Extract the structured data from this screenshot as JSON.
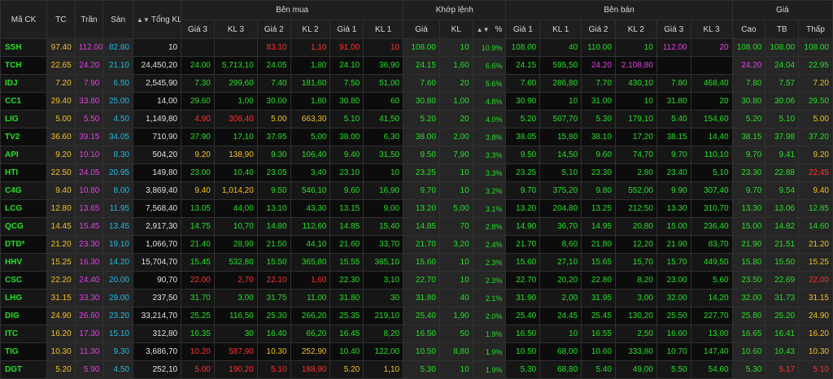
{
  "colors": {
    "ref": "#f0c020",
    "ceil": "#e040e0",
    "floor": "#20b8e0",
    "up": "#22e022",
    "down": "#ff3030",
    "vol": "#e0e0e0"
  },
  "header": {
    "symbol": "Mã CK",
    "ref": "TC",
    "ceil": "Trần",
    "floor": "Sàn",
    "total": "Tổng KL",
    "total_sort_icon": "sort-updown-icon",
    "buy_group": "Bên mua",
    "match_group": "Khớp lệnh",
    "sell_group": "Bên bán",
    "price_group": "Giá",
    "bid3": "Giá 3",
    "bvol3": "KL 3",
    "bid2": "Giá 2",
    "bvol2": "KL 2",
    "bid1": "Giá 1",
    "bvol1": "KL 1",
    "match_price": "Giá",
    "match_vol": "KL",
    "pct": "%",
    "pct_sort_icon": "sort-updown-icon",
    "ask1": "Giá 1",
    "avol1": "KL 1",
    "ask2": "Giá 2",
    "avol2": "KL 2",
    "ask3": "Giá 3",
    "avol3": "KL 3",
    "high": "Cao",
    "avg": "TB",
    "low": "Thấp"
  },
  "rows": [
    {
      "sym": "SSH",
      "tc": "97.40",
      "tran": "112.00",
      "san": "82.80",
      "tkl": "10",
      "g3": "",
      "k3": "",
      "g2": "83.10",
      "k2": "1,10",
      "g1": "91.00",
      "k1": "10",
      "mp": "108.00",
      "mv": "10",
      "pct": "10.9%",
      "ag1": "108.00",
      "ak1": "40",
      "ag2": "110.00",
      "ak2": "10",
      "ag3": "112.00",
      "ak3": "20",
      "hi": "108.00",
      "tb": "108.00",
      "lo": "108.00",
      "c": {
        "sym": "up",
        "g2": "down",
        "k2": "down",
        "g1": "down",
        "k1": "down",
        "mp": "up",
        "mv": "up",
        "pct": "up",
        "ag1": "up",
        "ak1": "up",
        "ag2": "up",
        "ak2": "up",
        "ag3": "ceil",
        "ak3": "ceil",
        "hi": "up",
        "tb": "up",
        "lo": "up"
      }
    },
    {
      "sym": "TCH",
      "tc": "22.65",
      "tran": "24.20",
      "san": "21.10",
      "tkl": "24,450,20",
      "g3": "24.00",
      "k3": "5,713,10",
      "g2": "24.05",
      "k2": "1,80",
      "g1": "24.10",
      "k1": "36,90",
      "mp": "24.15",
      "mv": "1,60",
      "pct": "6.6%",
      "ag1": "24.15",
      "ak1": "595,50",
      "ag2": "24.20",
      "ak2": "2,108,80",
      "ag3": "",
      "ak3": "",
      "hi": "24.20",
      "tb": "24.04",
      "lo": "22.95",
      "c": {
        "sym": "up",
        "g3": "up",
        "k3": "up",
        "g2": "up",
        "k2": "up",
        "g1": "up",
        "k1": "up",
        "mp": "up",
        "mv": "up",
        "pct": "up",
        "ag1": "up",
        "ak1": "up",
        "ag2": "ceil",
        "ak2": "ceil",
        "hi": "ceil",
        "tb": "up",
        "lo": "up"
      }
    },
    {
      "sym": "IDJ",
      "tc": "7.20",
      "tran": "7.90",
      "san": "6.50",
      "tkl": "2,545,90",
      "g3": "7.30",
      "k3": "299,60",
      "g2": "7.40",
      "k2": "181,60",
      "g1": "7.50",
      "k1": "51,00",
      "mp": "7.60",
      "mv": "20",
      "pct": "5.6%",
      "ag1": "7.60",
      "ak1": "286,80",
      "ag2": "7.70",
      "ak2": "430,10",
      "ag3": "7.80",
      "ak3": "468,40",
      "hi": "7.80",
      "tb": "7.57",
      "lo": "7.20",
      "c": {
        "sym": "up",
        "g3": "up",
        "k3": "up",
        "g2": "up",
        "k2": "up",
        "g1": "up",
        "k1": "up",
        "mp": "up",
        "mv": "up",
        "pct": "up",
        "ag1": "up",
        "ak1": "up",
        "ag2": "up",
        "ak2": "up",
        "ag3": "up",
        "ak3": "up",
        "hi": "up",
        "tb": "up",
        "lo": "ref"
      }
    },
    {
      "sym": "CC1",
      "tc": "29.40",
      "tran": "33.80",
      "san": "25.00",
      "tkl": "14,00",
      "g3": "29.60",
      "k3": "1,00",
      "g2": "30.00",
      "k2": "1,80",
      "g1": "30.80",
      "k1": "60",
      "mp": "30.80",
      "mv": "1,00",
      "pct": "4.8%",
      "ag1": "30.90",
      "ak1": "10",
      "ag2": "31.00",
      "ak2": "10",
      "ag3": "31.80",
      "ak3": "20",
      "hi": "30.80",
      "tb": "30.06",
      "lo": "29.50",
      "c": {
        "sym": "up",
        "g3": "up",
        "k3": "up",
        "g2": "up",
        "k2": "up",
        "g1": "up",
        "k1": "up",
        "mp": "up",
        "mv": "up",
        "pct": "up",
        "ag1": "up",
        "ak1": "up",
        "ag2": "up",
        "ak2": "up",
        "ag3": "up",
        "ak3": "up",
        "hi": "up",
        "tb": "up",
        "lo": "up"
      }
    },
    {
      "sym": "LIG",
      "tc": "5.00",
      "tran": "5.50",
      "san": "4.50",
      "tkl": "1,149,80",
      "g3": "4.90",
      "k3": "308,40",
      "g2": "5.00",
      "k2": "663,30",
      "g1": "5.10",
      "k1": "41,50",
      "mp": "5.20",
      "mv": "20",
      "pct": "4.0%",
      "ag1": "5.20",
      "ak1": "507,70",
      "ag2": "5.30",
      "ak2": "179,10",
      "ag3": "5.40",
      "ak3": "154,60",
      "hi": "5.20",
      "tb": "5.10",
      "lo": "5.00",
      "c": {
        "sym": "up",
        "g3": "down",
        "k3": "down",
        "g2": "ref",
        "k2": "ref",
        "g1": "up",
        "k1": "up",
        "mp": "up",
        "mv": "up",
        "pct": "up",
        "ag1": "up",
        "ak1": "up",
        "ag2": "up",
        "ak2": "up",
        "ag3": "up",
        "ak3": "up",
        "hi": "up",
        "tb": "up",
        "lo": "ref"
      }
    },
    {
      "sym": "TV2",
      "tc": "36.60",
      "tran": "39.15",
      "san": "34.05",
      "tkl": "710,90",
      "g3": "37.90",
      "k3": "17,10",
      "g2": "37.95",
      "k2": "5,00",
      "g1": "38.00",
      "k1": "6,30",
      "mp": "38.00",
      "mv": "2,00",
      "pct": "3.8%",
      "ag1": "38.05",
      "ak1": "15,80",
      "ag2": "38.10",
      "ak2": "17,20",
      "ag3": "38.15",
      "ak3": "14,40",
      "hi": "38.15",
      "tb": "37.98",
      "lo": "37.20",
      "c": {
        "sym": "up",
        "g3": "up",
        "k3": "up",
        "g2": "up",
        "k2": "up",
        "g1": "up",
        "k1": "up",
        "mp": "up",
        "mv": "up",
        "pct": "up",
        "ag1": "up",
        "ak1": "up",
        "ag2": "up",
        "ak2": "up",
        "ag3": "up",
        "ak3": "up",
        "hi": "up",
        "tb": "up",
        "lo": "up"
      }
    },
    {
      "sym": "API",
      "tc": "9.20",
      "tran": "10.10",
      "san": "8.30",
      "tkl": "504,20",
      "g3": "9.20",
      "k3": "138,90",
      "g2": "9.30",
      "k2": "106,40",
      "g1": "9.40",
      "k1": "31,50",
      "mp": "9.50",
      "mv": "7,90",
      "pct": "3.3%",
      "ag1": "9.50",
      "ak1": "14,50",
      "ag2": "9.60",
      "ak2": "74,70",
      "ag3": "9.70",
      "ak3": "110,10",
      "hi": "9.70",
      "tb": "9.41",
      "lo": "9.20",
      "c": {
        "sym": "up",
        "g3": "ref",
        "k3": "ref",
        "g2": "up",
        "k2": "up",
        "g1": "up",
        "k1": "up",
        "mp": "up",
        "mv": "up",
        "pct": "up",
        "ag1": "up",
        "ak1": "up",
        "ag2": "up",
        "ak2": "up",
        "ag3": "up",
        "ak3": "up",
        "hi": "up",
        "tb": "up",
        "lo": "ref"
      }
    },
    {
      "sym": "HTI",
      "tc": "22.50",
      "tran": "24.05",
      "san": "20.95",
      "tkl": "149,80",
      "g3": "23.00",
      "k3": "10,40",
      "g2": "23.05",
      "k2": "3,40",
      "g1": "23.10",
      "k1": "10",
      "mp": "23.25",
      "mv": "10",
      "pct": "3.3%",
      "ag1": "23.25",
      "ak1": "5,10",
      "ag2": "23.30",
      "ak2": "2,80",
      "ag3": "23.40",
      "ak3": "5,10",
      "hi": "23.30",
      "tb": "22.88",
      "lo": "22.45",
      "c": {
        "sym": "up",
        "g3": "up",
        "k3": "up",
        "g2": "up",
        "k2": "up",
        "g1": "up",
        "k1": "up",
        "mp": "up",
        "mv": "up",
        "pct": "up",
        "ag1": "up",
        "ak1": "up",
        "ag2": "up",
        "ak2": "up",
        "ag3": "up",
        "ak3": "up",
        "hi": "up",
        "tb": "up",
        "lo": "down"
      }
    },
    {
      "sym": "C4G",
      "tc": "9.40",
      "tran": "10.80",
      "san": "8.00",
      "tkl": "3,869,40",
      "g3": "9.40",
      "k3": "1,014,20",
      "g2": "9.50",
      "k2": "546,10",
      "g1": "9.60",
      "k1": "16,90",
      "mp": "9.70",
      "mv": "10",
      "pct": "3.2%",
      "ag1": "9.70",
      "ak1": "375,20",
      "ag2": "9.80",
      "ak2": "552,00",
      "ag3": "9.90",
      "ak3": "307,40",
      "hi": "9.70",
      "tb": "9.54",
      "lo": "9.40",
      "c": {
        "sym": "up",
        "g3": "ref",
        "k3": "ref",
        "g2": "up",
        "k2": "up",
        "g1": "up",
        "k1": "up",
        "mp": "up",
        "mv": "up",
        "pct": "up",
        "ag1": "up",
        "ak1": "up",
        "ag2": "up",
        "ak2": "up",
        "ag3": "up",
        "ak3": "up",
        "hi": "up",
        "tb": "up",
        "lo": "ref"
      }
    },
    {
      "sym": "LCG",
      "tc": "12.80",
      "tran": "13.65",
      "san": "11.95",
      "tkl": "7,568,40",
      "g3": "13.05",
      "k3": "44,00",
      "g2": "13.10",
      "k2": "43,30",
      "g1": "13.15",
      "k1": "9,00",
      "mp": "13.20",
      "mv": "5,00",
      "pct": "3.1%",
      "ag1": "13.20",
      "ak1": "204,80",
      "ag2": "13.25",
      "ak2": "212,50",
      "ag3": "13.30",
      "ak3": "310,70",
      "hi": "13.30",
      "tb": "13.06",
      "lo": "12.85",
      "c": {
        "sym": "up",
        "g3": "up",
        "k3": "up",
        "g2": "up",
        "k2": "up",
        "g1": "up",
        "k1": "up",
        "mp": "up",
        "mv": "up",
        "pct": "up",
        "ag1": "up",
        "ak1": "up",
        "ag2": "up",
        "ak2": "up",
        "ag3": "up",
        "ak3": "up",
        "hi": "up",
        "tb": "up",
        "lo": "up"
      }
    },
    {
      "sym": "QCG",
      "tc": "14.45",
      "tran": "15.45",
      "san": "13.45",
      "tkl": "2,917,30",
      "g3": "14.75",
      "k3": "10,70",
      "g2": "14.80",
      "k2": "112,60",
      "g1": "14.85",
      "k1": "15,40",
      "mp": "14.85",
      "mv": "70",
      "pct": "2.8%",
      "ag1": "14.90",
      "ak1": "36,70",
      "ag2": "14.95",
      "ak2": "20,80",
      "ag3": "15.00",
      "ak3": "236,40",
      "hi": "15.00",
      "tb": "14.82",
      "lo": "14.60",
      "c": {
        "sym": "up",
        "g3": "up",
        "k3": "up",
        "g2": "up",
        "k2": "up",
        "g1": "up",
        "k1": "up",
        "mp": "up",
        "mv": "up",
        "pct": "up",
        "ag1": "up",
        "ak1": "up",
        "ag2": "up",
        "ak2": "up",
        "ag3": "up",
        "ak3": "up",
        "hi": "up",
        "tb": "up",
        "lo": "up"
      }
    },
    {
      "sym": "DTD*",
      "tc": "21.20",
      "tran": "23.30",
      "san": "19.10",
      "tkl": "1,066,70",
      "g3": "21.40",
      "k3": "28,90",
      "g2": "21.50",
      "k2": "44,10",
      "g1": "21.60",
      "k1": "33,70",
      "mp": "21.70",
      "mv": "3,20",
      "pct": "2.4%",
      "ag1": "21.70",
      "ak1": "8,60",
      "ag2": "21.80",
      "ak2": "12,20",
      "ag3": "21.90",
      "ak3": "83,70",
      "hi": "21.90",
      "tb": "21.51",
      "lo": "21.20",
      "c": {
        "sym": "up",
        "g3": "up",
        "k3": "up",
        "g2": "up",
        "k2": "up",
        "g1": "up",
        "k1": "up",
        "mp": "up",
        "mv": "up",
        "pct": "up",
        "ag1": "up",
        "ak1": "up",
        "ag2": "up",
        "ak2": "up",
        "ag3": "up",
        "ak3": "up",
        "hi": "up",
        "tb": "up",
        "lo": "ref"
      }
    },
    {
      "sym": "HHV",
      "tc": "15.25",
      "tran": "16.30",
      "san": "14.20",
      "tkl": "15,704,70",
      "g3": "15.45",
      "k3": "532,80",
      "g2": "15.50",
      "k2": "365,80",
      "g1": "15.55",
      "k1": "365,10",
      "mp": "15.60",
      "mv": "10",
      "pct": "2.3%",
      "ag1": "15.60",
      "ak1": "27,10",
      "ag2": "15.65",
      "ak2": "15,70",
      "ag3": "15.70",
      "ak3": "449,50",
      "hi": "15.80",
      "tb": "15.50",
      "lo": "15.25",
      "c": {
        "sym": "up",
        "g3": "up",
        "k3": "up",
        "g2": "up",
        "k2": "up",
        "g1": "up",
        "k1": "up",
        "mp": "up",
        "mv": "up",
        "pct": "up",
        "ag1": "up",
        "ak1": "up",
        "ag2": "up",
        "ak2": "up",
        "ag3": "up",
        "ak3": "up",
        "hi": "up",
        "tb": "up",
        "lo": "ref"
      }
    },
    {
      "sym": "CSC",
      "tc": "22.20",
      "tran": "24.40",
      "san": "20.00",
      "tkl": "90,70",
      "g3": "22.00",
      "k3": "2,70",
      "g2": "22.10",
      "k2": "1,60",
      "g1": "22.30",
      "k1": "3,10",
      "mp": "22.70",
      "mv": "10",
      "pct": "2.3%",
      "ag1": "22.70",
      "ak1": "20,20",
      "ag2": "22.80",
      "ak2": "8,20",
      "ag3": "23.00",
      "ak3": "5,60",
      "hi": "23.50",
      "tb": "22.69",
      "lo": "22.00",
      "c": {
        "sym": "up",
        "g3": "down",
        "k3": "down",
        "g2": "down",
        "k2": "down",
        "g1": "up",
        "k1": "up",
        "mp": "up",
        "mv": "up",
        "pct": "up",
        "ag1": "up",
        "ak1": "up",
        "ag2": "up",
        "ak2": "up",
        "ag3": "up",
        "ak3": "up",
        "hi": "up",
        "tb": "up",
        "lo": "down"
      }
    },
    {
      "sym": "LHG",
      "tc": "31.15",
      "tran": "33.30",
      "san": "29.00",
      "tkl": "237,50",
      "g3": "31.70",
      "k3": "3,00",
      "g2": "31.75",
      "k2": "11,00",
      "g1": "31.80",
      "k1": "30",
      "mp": "31.80",
      "mv": "40",
      "pct": "2.1%",
      "ag1": "31.90",
      "ak1": "2,00",
      "ag2": "31.95",
      "ak2": "3,00",
      "ag3": "32.00",
      "ak3": "14,20",
      "hi": "32.00",
      "tb": "31.73",
      "lo": "31.15",
      "c": {
        "sym": "up",
        "g3": "up",
        "k3": "up",
        "g2": "up",
        "k2": "up",
        "g1": "up",
        "k1": "up",
        "mp": "up",
        "mv": "up",
        "pct": "up",
        "ag1": "up",
        "ak1": "up",
        "ag2": "up",
        "ak2": "up",
        "ag3": "up",
        "ak3": "up",
        "hi": "up",
        "tb": "up",
        "lo": "ref"
      }
    },
    {
      "sym": "DIG",
      "tc": "24.90",
      "tran": "26.60",
      "san": "23.20",
      "tkl": "33,214,70",
      "g3": "25.25",
      "k3": "116,50",
      "g2": "25.30",
      "k2": "266,20",
      "g1": "25.35",
      "k1": "219,10",
      "mp": "25.40",
      "mv": "1,90",
      "pct": "2.0%",
      "ag1": "25.40",
      "ak1": "24.45",
      "ag2": "25.45",
      "ak2": "130,20",
      "ag3": "25.50",
      "ak3": "227,70",
      "hi": "25.80",
      "tb": "25.20",
      "lo": "24.90",
      "c": {
        "sym": "up",
        "g3": "up",
        "k3": "up",
        "g2": "up",
        "k2": "up",
        "g1": "up",
        "k1": "up",
        "mp": "up",
        "mv": "up",
        "pct": "up",
        "ag1": "up",
        "ak1": "up",
        "ag2": "up",
        "ak2": "up",
        "ag3": "up",
        "ak3": "up",
        "hi": "up",
        "tb": "up",
        "lo": "ref"
      }
    },
    {
      "sym": "ITC",
      "tc": "16.20",
      "tran": "17.30",
      "san": "15.10",
      "tkl": "312,80",
      "g3": "16.35",
      "k3": "30",
      "g2": "16.40",
      "k2": "66,20",
      "g1": "16.45",
      "k1": "8,20",
      "mp": "16.50",
      "mv": "50",
      "pct": "1.9%",
      "ag1": "16.50",
      "ak1": "10",
      "ag2": "16.55",
      "ak2": "2,50",
      "ag3": "16.60",
      "ak3": "13,00",
      "hi": "16.65",
      "tb": "16.41",
      "lo": "16.20",
      "c": {
        "sym": "up",
        "g3": "up",
        "k3": "up",
        "g2": "up",
        "k2": "up",
        "g1": "up",
        "k1": "up",
        "mp": "up",
        "mv": "up",
        "pct": "up",
        "ag1": "up",
        "ak1": "up",
        "ag2": "up",
        "ak2": "up",
        "ag3": "up",
        "ak3": "up",
        "hi": "up",
        "tb": "up",
        "lo": "ref"
      }
    },
    {
      "sym": "TIG",
      "tc": "10.30",
      "tran": "11.30",
      "san": "9.30",
      "tkl": "3,686,70",
      "g3": "10.20",
      "k3": "587,90",
      "g2": "10.30",
      "k2": "252,90",
      "g1": "10.40",
      "k1": "122,00",
      "mp": "10.50",
      "mv": "8,80",
      "pct": "1.9%",
      "ag1": "10.50",
      "ak1": "68,00",
      "ag2": "10.60",
      "ak2": "333,80",
      "ag3": "10.70",
      "ak3": "147,40",
      "hi": "10.60",
      "tb": "10.43",
      "lo": "10.30",
      "c": {
        "sym": "up",
        "g3": "down",
        "k3": "down",
        "g2": "ref",
        "k2": "ref",
        "g1": "up",
        "k1": "up",
        "mp": "up",
        "mv": "up",
        "pct": "up",
        "ag1": "up",
        "ak1": "up",
        "ag2": "up",
        "ak2": "up",
        "ag3": "up",
        "ak3": "up",
        "hi": "up",
        "tb": "up",
        "lo": "ref"
      }
    },
    {
      "sym": "DGT",
      "tc": "5.20",
      "tran": "5.90",
      "san": "4.50",
      "tkl": "252,10",
      "g3": "5.00",
      "k3": "190,20",
      "g2": "5.10",
      "k2": "188,90",
      "g1": "5.20",
      "k1": "1,10",
      "mp": "5.30",
      "mv": "10",
      "pct": "1.9%",
      "ag1": "5.30",
      "ak1": "68,80",
      "ag2": "5.40",
      "ak2": "49,00",
      "ag3": "5.50",
      "ak3": "54,60",
      "hi": "5.30",
      "tb": "5.17",
      "lo": "5.10",
      "c": {
        "sym": "up",
        "g3": "down",
        "k3": "down",
        "g2": "down",
        "k2": "down",
        "g1": "ref",
        "k1": "ref",
        "mp": "up",
        "mv": "up",
        "pct": "up",
        "ag1": "up",
        "ak1": "up",
        "ag2": "up",
        "ak2": "up",
        "ag3": "up",
        "ak3": "up",
        "hi": "up",
        "tb": "down",
        "lo": "down"
      }
    }
  ]
}
